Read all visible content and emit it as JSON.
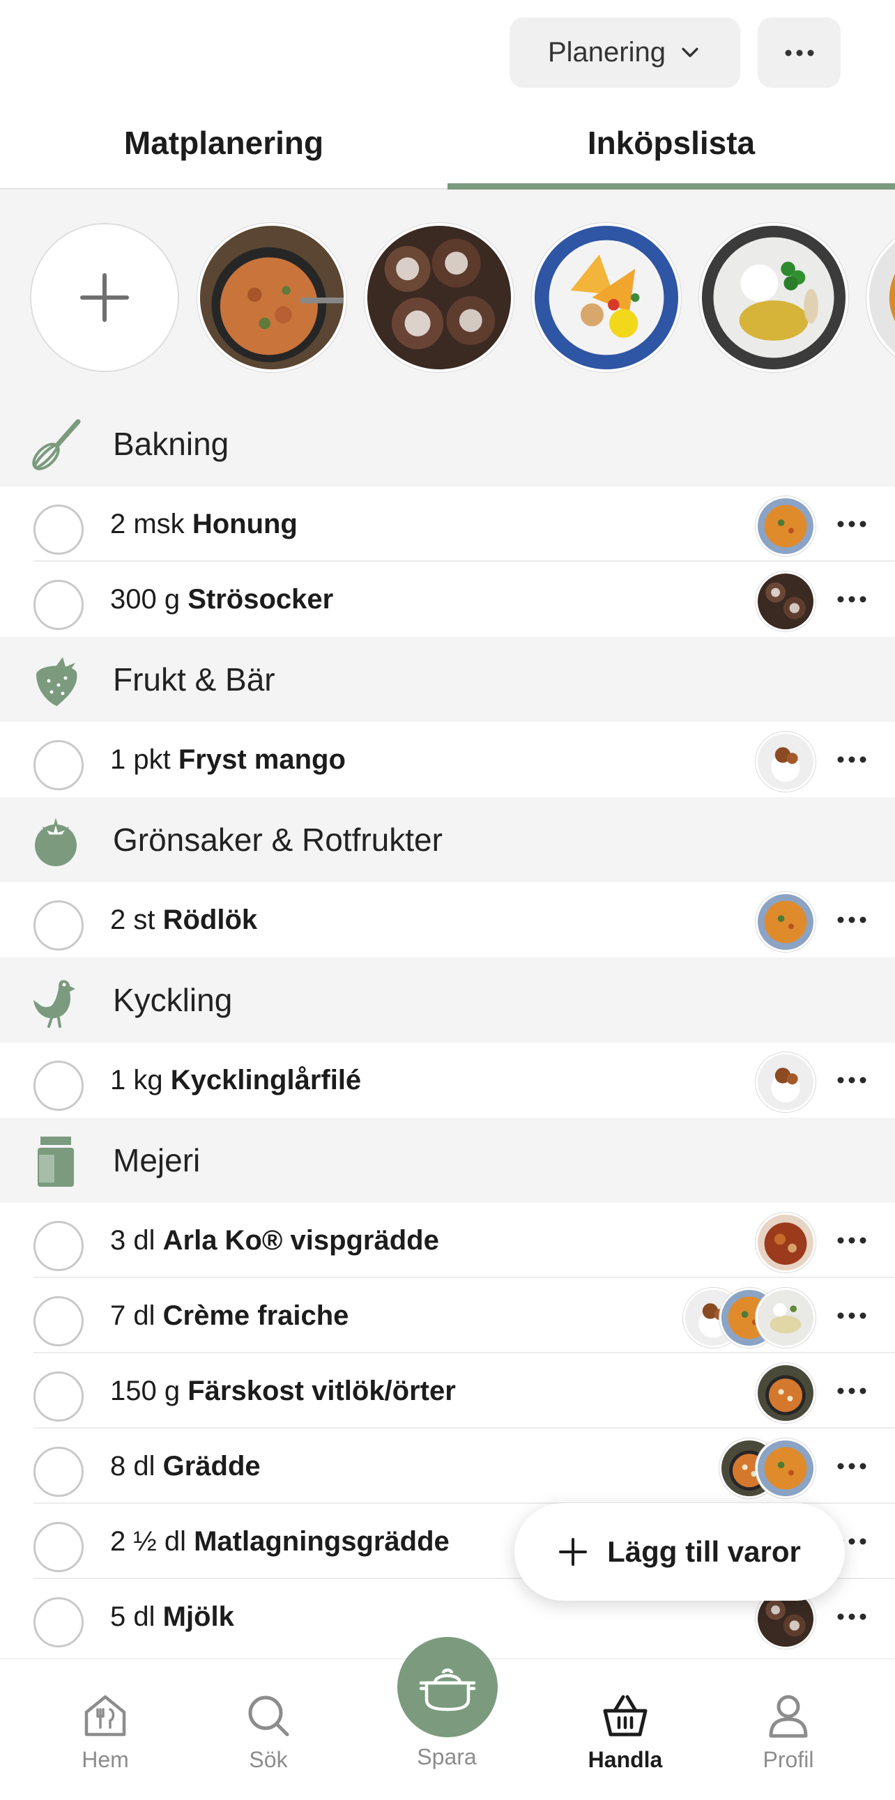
{
  "header": {
    "dropdown_label": "Planering",
    "more_label": "···"
  },
  "tabs": [
    {
      "label": "Matplanering",
      "active": false
    },
    {
      "label": "Inköpslista",
      "active": true
    }
  ],
  "recipes_strip": {
    "items": [
      "stew-pan",
      "cinnamon-buns",
      "nachos-plate",
      "fish-plate",
      "soup-bowl"
    ]
  },
  "categories": [
    {
      "label": "Bakning",
      "icon": "whisk-icon",
      "items": [
        {
          "qty": "2 msk",
          "name": "Honung",
          "thumbs": [
            "soup"
          ]
        },
        {
          "qty": "300 g",
          "name": "Strösocker",
          "thumbs": [
            "buns"
          ]
        }
      ]
    },
    {
      "label": "Frukt & Bär",
      "icon": "strawberry-icon",
      "items": [
        {
          "qty": "1 pkt",
          "name": "Fryst mango",
          "thumbs": [
            "chicken-rice"
          ]
        }
      ]
    },
    {
      "label": "Grönsaker & Rotfrukter",
      "icon": "tomato-icon",
      "items": [
        {
          "qty": "2 st",
          "name": "Rödlök",
          "thumbs": [
            "soup"
          ]
        }
      ]
    },
    {
      "label": "Kyckling",
      "icon": "hen-icon",
      "items": [
        {
          "qty": "1 kg",
          "name": "Kycklinglårfilé",
          "thumbs": [
            "chicken-rice"
          ]
        }
      ]
    },
    {
      "label": "Mejeri",
      "icon": "milk-carton-icon",
      "items": [
        {
          "qty": "3 dl",
          "name": "Arla Ko® vispgrädde",
          "thumbs": [
            "stew"
          ]
        },
        {
          "qty": "7 dl",
          "name": "Crème fraiche",
          "thumbs": [
            "fish",
            "soup",
            "chicken-rice"
          ]
        },
        {
          "qty": "150 g",
          "name": "Färskost vitlök/örter",
          "thumbs": [
            "pan"
          ]
        },
        {
          "qty": "8 dl",
          "name": "Grädde",
          "thumbs": [
            "soup",
            "pan"
          ]
        },
        {
          "qty": "2 ½ dl",
          "name": "Matlagningsgrädde",
          "thumbs": [
            "fish"
          ]
        },
        {
          "qty": "5 dl",
          "name": "Mjölk",
          "thumbs": [
            "buns"
          ]
        }
      ]
    }
  ],
  "fab": {
    "label": "Lägg till varor"
  },
  "bottom_nav": [
    {
      "label": "Hem",
      "icon": "home-icon",
      "active": false
    },
    {
      "label": "Sök",
      "icon": "search-icon",
      "active": false
    },
    {
      "label": "Spara",
      "icon": "pot-icon",
      "active": false
    },
    {
      "label": "Handla",
      "icon": "basket-icon",
      "active": true
    },
    {
      "label": "Profil",
      "icon": "profile-icon",
      "active": false
    }
  ],
  "colors": {
    "accent": "#7b9a7e",
    "category_bg": "#f4f4f4",
    "text": "#1c1c1c",
    "muted": "#8c8c8c"
  }
}
